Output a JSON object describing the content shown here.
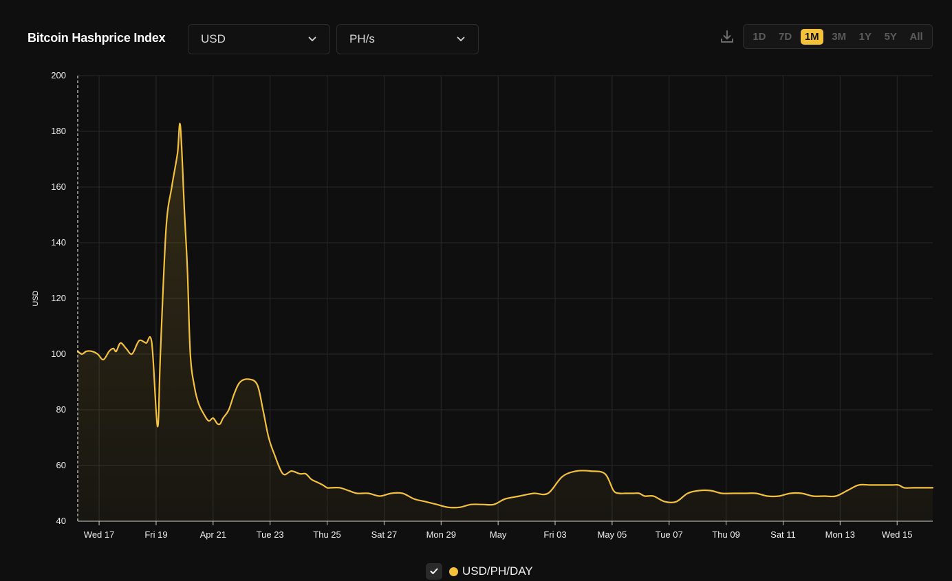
{
  "header": {
    "title": "Bitcoin Hashprice Index",
    "currency_select": "USD",
    "unit_select": "PH/s",
    "download_icon": "download-icon",
    "ranges": [
      "1D",
      "7D",
      "1M",
      "3M",
      "1Y",
      "5Y",
      "All"
    ],
    "active_range": "1M"
  },
  "colors": {
    "background": "#0f0f0f",
    "line": "#f4c23a",
    "grid": "#2a2a2a",
    "active_range": "#f4c23a"
  },
  "legend": {
    "label": "USD/PH/DAY",
    "checked": true
  },
  "chart_data": {
    "type": "area",
    "title": "Bitcoin Hashprice Index",
    "xlabel": "",
    "ylabel": "USD",
    "ylim": [
      40,
      200
    ],
    "yticks": [
      40,
      60,
      80,
      100,
      120,
      140,
      160,
      180,
      200
    ],
    "xlim": [
      0,
      30
    ],
    "xtick_positions": [
      0.75,
      2.75,
      4.75,
      6.75,
      8.75,
      10.75,
      12.75,
      14.75,
      16.75,
      18.75,
      20.75,
      22.75,
      24.75,
      26.75,
      28.75
    ],
    "xtick_labels": [
      "Wed 17",
      "Fri 19",
      "Apr 21",
      "Tue 23",
      "Thu 25",
      "Sat 27",
      "Mon 29",
      "May",
      "Fri 03",
      "May 05",
      "Tue 07",
      "Thu 09",
      "Sat 11",
      "Mon 13",
      "Wed 15"
    ],
    "grid": true,
    "series": [
      {
        "name": "USD/PH/DAY",
        "x": [
          0,
          0.15,
          0.3,
          0.5,
          0.7,
          0.9,
          1.1,
          1.25,
          1.35,
          1.5,
          1.7,
          1.9,
          2.1,
          2.2,
          2.4,
          2.6,
          2.8,
          2.9,
          3.1,
          3.3,
          3.5,
          3.6,
          3.75,
          3.85,
          3.95,
          4.1,
          4.25,
          4.45,
          4.6,
          4.75,
          4.9,
          5.0,
          5.1,
          5.3,
          5.5,
          5.7,
          6.0,
          6.3,
          6.5,
          6.7,
          6.9,
          7.2,
          7.5,
          7.8,
          8.0,
          8.2,
          8.4,
          8.6,
          8.75,
          8.9,
          9.2,
          9.5,
          9.8,
          10.2,
          10.6,
          11.0,
          11.4,
          11.8,
          12.2,
          12.6,
          13.0,
          13.4,
          13.8,
          14.2,
          14.6,
          15.0,
          15.5,
          16.0,
          16.5,
          17.0,
          17.5,
          18.0,
          18.5,
          18.8,
          19.0,
          19.2,
          19.5,
          19.7,
          19.9,
          20.2,
          20.6,
          21.0,
          21.4,
          21.8,
          22.2,
          22.6,
          23.0,
          23.4,
          23.8,
          24.2,
          24.6,
          25.0,
          25.4,
          25.8,
          26.2,
          26.6,
          27.0,
          27.4,
          27.8,
          28.2,
          28.6,
          28.8,
          29.0,
          29.3,
          29.6,
          30.0
        ],
        "y": [
          101,
          100,
          101,
          101,
          100,
          98,
          101,
          102,
          101,
          104,
          102,
          100,
          104,
          105,
          104,
          104,
          74,
          100,
          145,
          160,
          172,
          182,
          150,
          130,
          100,
          88,
          82,
          78,
          76,
          77,
          75,
          75,
          77,
          80,
          86,
          90,
          91,
          89,
          80,
          70,
          64,
          57,
          58,
          57,
          57,
          55,
          54,
          53,
          52,
          52,
          52,
          51,
          50,
          50,
          49,
          50,
          50,
          48,
          47,
          46,
          45,
          45,
          46,
          46,
          46,
          48,
          49,
          50,
          50,
          56,
          58,
          58,
          57,
          51,
          50,
          50,
          50,
          50,
          49,
          49,
          47,
          47,
          50,
          51,
          51,
          50,
          50,
          50,
          50,
          49,
          49,
          50,
          50,
          49,
          49,
          49,
          51,
          53,
          53,
          53,
          53,
          53,
          52,
          52,
          52,
          52
        ]
      }
    ]
  }
}
